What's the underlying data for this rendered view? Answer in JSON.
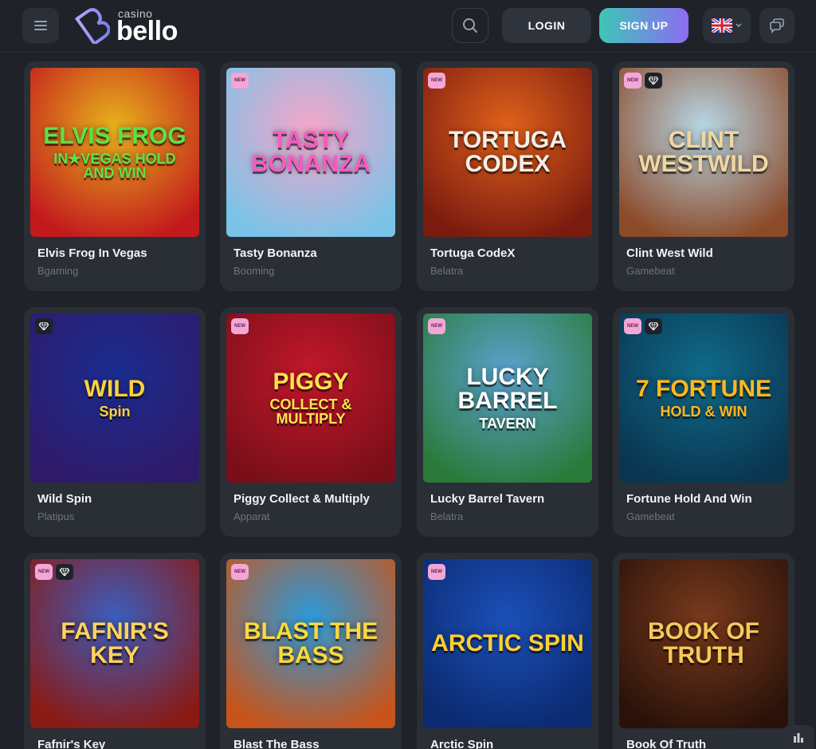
{
  "header": {
    "logo_small": "casino",
    "logo_big": "bello",
    "login_label": "LOGIN",
    "signup_label": "SIGN UP",
    "language": "en-GB flag"
  },
  "badges": {
    "new": "NEW"
  },
  "games": [
    {
      "name": "Elvis Frog In Vegas",
      "provider": "Bgaming",
      "art_title": "ELVIS FROG",
      "art_sub": "IN★VEGAS HOLD AND WIN",
      "is_new": false,
      "has_gem": false,
      "bg": "#e7b21b",
      "bg2": "#c2191d",
      "fg": "#5ee04a"
    },
    {
      "name": "Tasty Bonanza",
      "provider": "Booming",
      "art_title": "TASTY BONANZA",
      "art_sub": "",
      "is_new": true,
      "has_gem": false,
      "bg": "#f4a6c9",
      "bg2": "#7ac3e8",
      "fg": "#f85bc5"
    },
    {
      "name": "Tortuga CodeX",
      "provider": "Belatra",
      "art_title": "TORTUGA CODEX",
      "art_sub": "",
      "is_new": true,
      "has_gem": false,
      "bg": "#e0611c",
      "bg2": "#7a1b0f",
      "fg": "#f3f0e8"
    },
    {
      "name": "Clint West Wild",
      "provider": "Gamebeat",
      "art_title": "CLINT WESTWILD",
      "art_sub": "",
      "is_new": true,
      "has_gem": true,
      "bg": "#b7d7e6",
      "bg2": "#8b4a28",
      "fg": "#f0d7a1"
    },
    {
      "name": "Wild Spin",
      "provider": "Platipus",
      "art_title": "WILD",
      "art_sub": "Spin",
      "is_new": false,
      "has_gem": true,
      "bg": "#1a2d8f",
      "bg2": "#2f1a6a",
      "fg": "#ffd23a"
    },
    {
      "name": "Piggy Collect & Multiply",
      "provider": "Apparat",
      "art_title": "PIGGY",
      "art_sub": "COLLECT & MULTIPLY",
      "is_new": true,
      "has_gem": false,
      "bg": "#c3182a",
      "bg2": "#7a0f1a",
      "fg": "#ffe34d"
    },
    {
      "name": "Lucky Barrel Tavern",
      "provider": "Belatra",
      "art_title": "LUCKY BARREL",
      "art_sub": "TAVERN",
      "is_new": true,
      "has_gem": false,
      "bg": "#5aa2d0",
      "bg2": "#2a7a3a",
      "fg": "#ffffff"
    },
    {
      "name": "Fortune Hold And Win",
      "provider": "Gamebeat",
      "art_title": "7 FORTUNE",
      "art_sub": "HOLD & WIN",
      "is_new": true,
      "has_gem": true,
      "bg": "#0f6b8a",
      "bg2": "#0a3550",
      "fg": "#ffb81e"
    },
    {
      "name": "Fafnir's Key",
      "provider": "",
      "art_title": "FAFNIR'S KEY",
      "art_sub": "",
      "is_new": true,
      "has_gem": true,
      "bg": "#3a5ec0",
      "bg2": "#8a1a14",
      "fg": "#ffd35c"
    },
    {
      "name": "Blast The Bass",
      "provider": "",
      "art_title": "BLAST THE BASS",
      "art_sub": "",
      "is_new": true,
      "has_gem": false,
      "bg": "#2a9bdc",
      "bg2": "#c7541a",
      "fg": "#ffd93a"
    },
    {
      "name": "Arctic Spin",
      "provider": "",
      "art_title": "ARCTIC SPIN",
      "art_sub": "",
      "is_new": true,
      "has_gem": false,
      "bg": "#1b4fb8",
      "bg2": "#0b2a70",
      "fg": "#ffcf2e"
    },
    {
      "name": "Book Of Truth",
      "provider": "",
      "art_title": "BOOK OF TRUTH",
      "art_sub": "",
      "is_new": false,
      "has_gem": false,
      "bg": "#7a3a1c",
      "bg2": "#2a120a",
      "fg": "#f6c85a"
    }
  ]
}
